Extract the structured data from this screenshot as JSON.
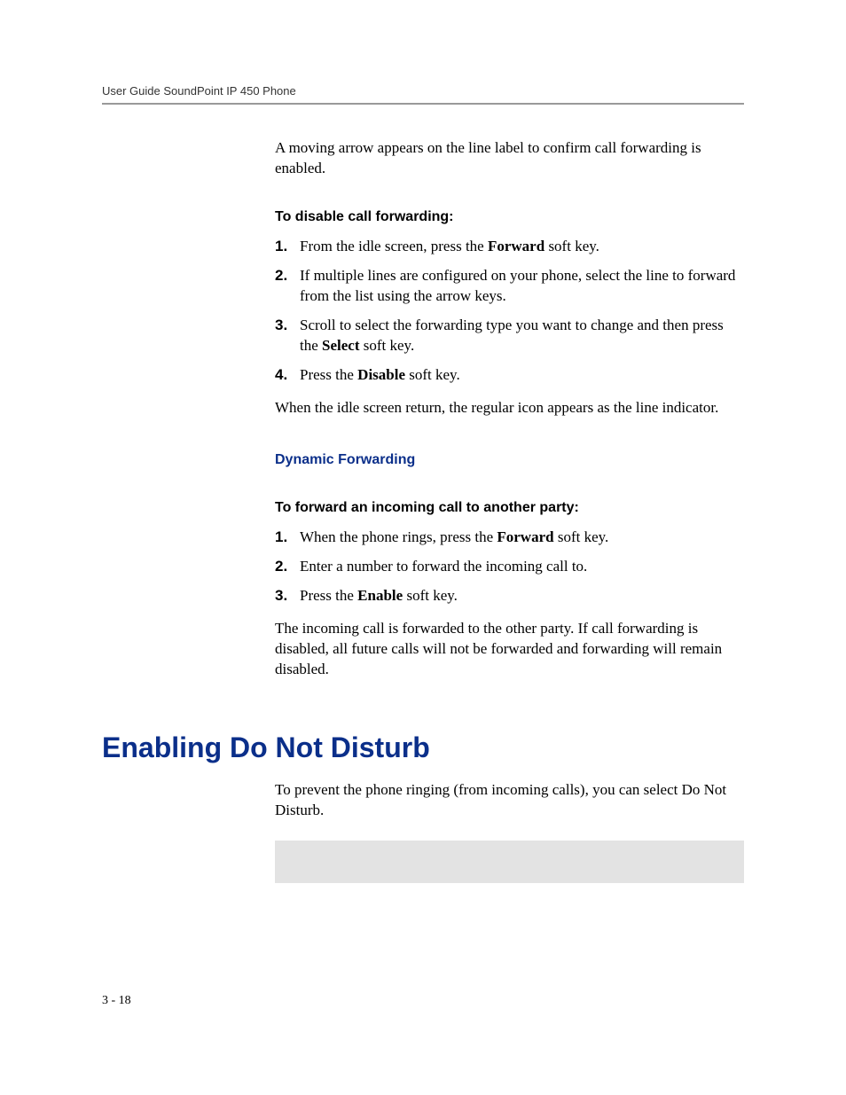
{
  "header": {
    "running": "User Guide SoundPoint IP 450 Phone"
  },
  "intro": {
    "text": "A moving arrow appears on the line label to confirm call forwarding is enabled."
  },
  "disable": {
    "heading": "To disable call forwarding:",
    "steps": [
      {
        "pre": "From the idle screen, press the ",
        "bold": "Forward",
        "post": " soft key."
      },
      {
        "pre": "If multiple lines are configured on your phone, select the line to forward from the list using the arrow keys.",
        "bold": "",
        "post": ""
      },
      {
        "pre": "Scroll to select the forwarding type you want to change and then press the ",
        "bold": "Select",
        "post": " soft key."
      },
      {
        "pre": "Press the ",
        "bold": "Disable",
        "post": " soft key."
      }
    ],
    "after": "When the idle screen return, the regular icon appears as the line indicator."
  },
  "dynamic": {
    "heading": "Dynamic Forwarding"
  },
  "forward_incoming": {
    "heading": "To forward an incoming call to another party:",
    "steps": [
      {
        "pre": "When the phone rings, press the ",
        "bold": "Forward",
        "post": " soft key."
      },
      {
        "pre": "Enter a number to forward the incoming call to.",
        "bold": "",
        "post": ""
      },
      {
        "pre": "Press the ",
        "bold": "Enable",
        "post": " soft key."
      }
    ],
    "after": "The incoming call is forwarded to the other party. If call forwarding is disabled, all future calls will not be forwarded and forwarding will remain disabled."
  },
  "dnd": {
    "title": "Enabling Do Not Disturb",
    "intro": "To prevent the phone ringing (from incoming calls), you can select Do Not Disturb."
  },
  "footer": {
    "page": "3 - 18"
  }
}
